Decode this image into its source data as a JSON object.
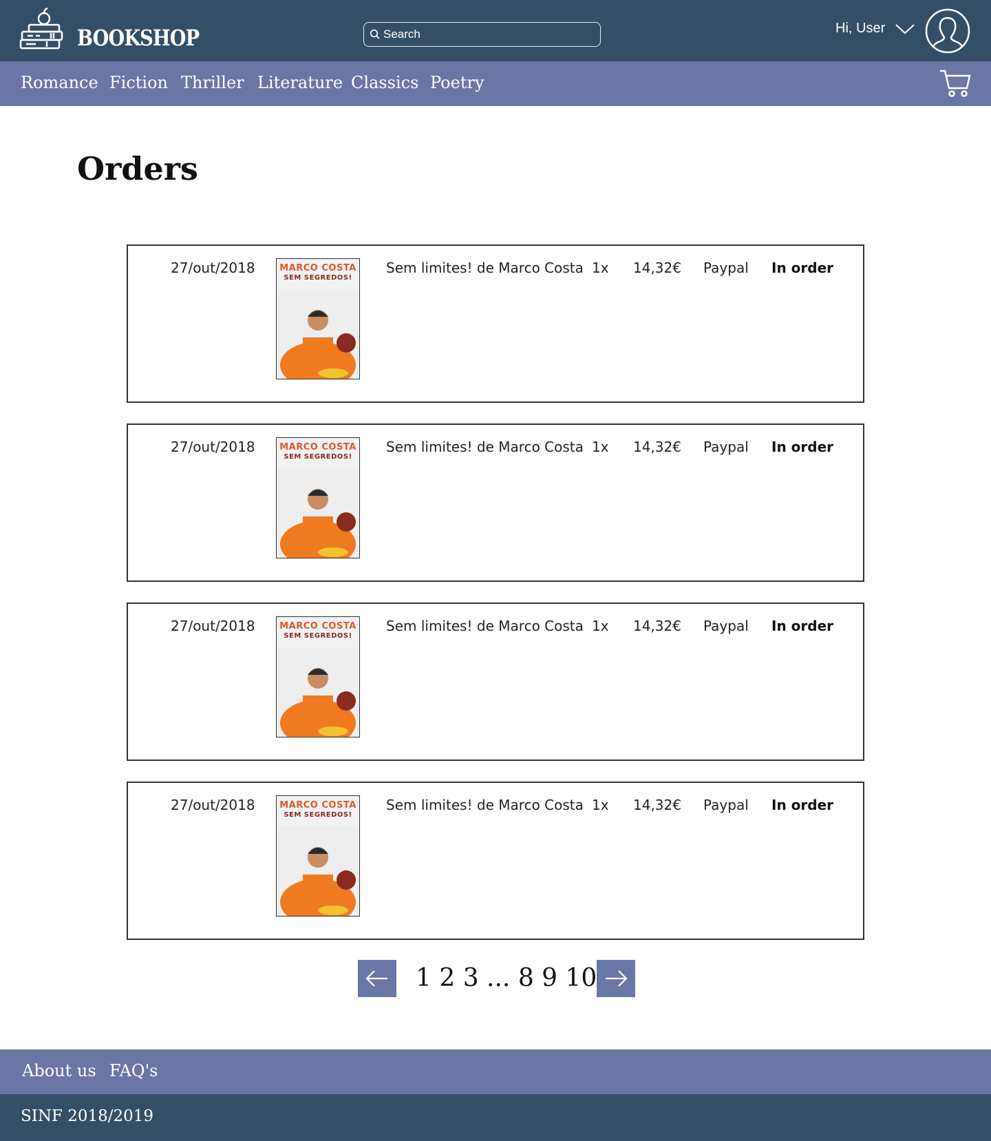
{
  "header": {
    "logo_text": "BOOKSHOP",
    "search_placeholder": "Search",
    "greeting": "Hi, User"
  },
  "nav": {
    "categories": [
      "Romance",
      "Fiction",
      "Thriller",
      "Literature",
      "Classics",
      "Poetry"
    ]
  },
  "main": {
    "title": "Orders",
    "orders": [
      {
        "date": "27/out/2018",
        "cover_author": "MARCO COSTA",
        "cover_title": "SEM SEGREDOS!",
        "book": "Sem limites! de Marco Costa",
        "quantity": "1x",
        "price": "14,32€",
        "payment": "Paypal",
        "status": "In order"
      },
      {
        "date": "27/out/2018",
        "cover_author": "MARCO COSTA",
        "cover_title": "SEM SEGREDOS!",
        "book": "Sem limites! de Marco Costa",
        "quantity": "1x",
        "price": "14,32€",
        "payment": "Paypal",
        "status": "In order"
      },
      {
        "date": "27/out/2018",
        "cover_author": "MARCO COSTA",
        "cover_title": "SEM SEGREDOS!",
        "book": "Sem limites! de Marco Costa",
        "quantity": "1x",
        "price": "14,32€",
        "payment": "Paypal",
        "status": "In order"
      },
      {
        "date": "27/out/2018",
        "cover_author": "MARCO COSTA",
        "cover_title": "SEM SEGREDOS!",
        "book": "Sem limites! de Marco Costa",
        "quantity": "1x",
        "price": "14,32€",
        "payment": "Paypal",
        "status": "In order"
      }
    ]
  },
  "pagination": {
    "pages": "1 2 3 ...  8 9 10",
    "prev_icon": "arrow-left-icon",
    "next_icon": "arrow-right-icon"
  },
  "footer": {
    "links": [
      "About us",
      "FAQ's"
    ],
    "copyright": "SINF 2018/2019"
  },
  "colors": {
    "header_bg": "#334f67",
    "nav_bg": "#6a76a3",
    "accent_orange": "#e8731f"
  }
}
